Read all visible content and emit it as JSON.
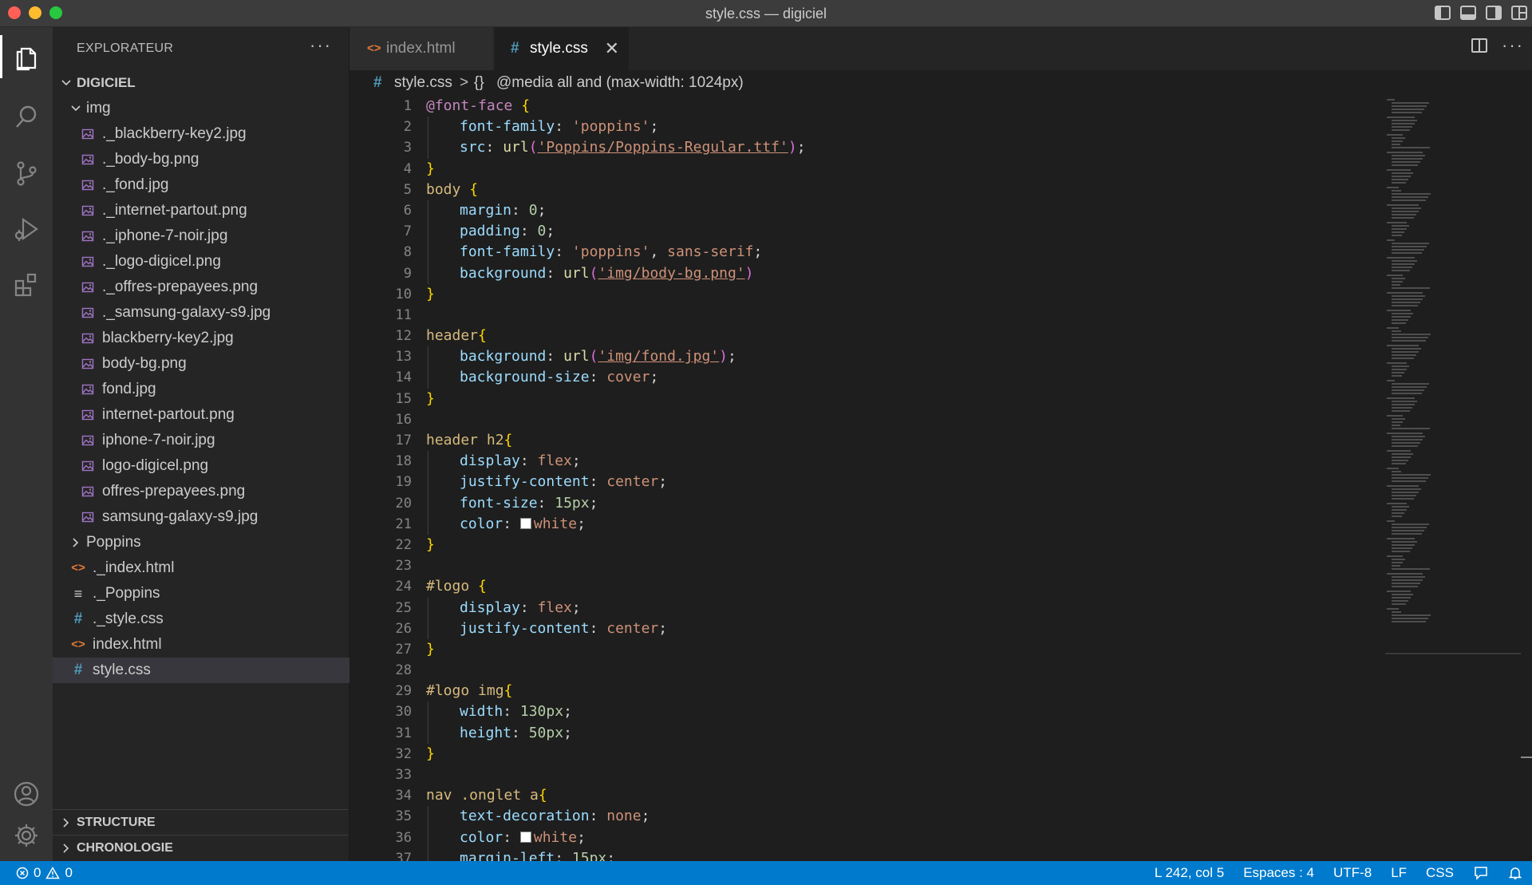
{
  "window": {
    "title": "style.css — digiciel"
  },
  "sidebar": {
    "title": "EXPLORATEUR",
    "more": "···",
    "root": "DIGICIEL",
    "img_folder": "img",
    "img_files": [
      "._blackberry-key2.jpg",
      "._body-bg.png",
      "._fond.jpg",
      "._internet-partout.png",
      "._iphone-7-noir.jpg",
      "._logo-digicel.png",
      "._offres-prepayees.png",
      "._samsung-galaxy-s9.jpg",
      "blackberry-key2.jpg",
      "body-bg.png",
      "fond.jpg",
      "internet-partout.png",
      "iphone-7-noir.jpg",
      "logo-digicel.png",
      "offres-prepayees.png",
      "samsung-galaxy-s9.jpg"
    ],
    "poppins_folder": "Poppins",
    "root_files": [
      {
        "name": "._index.html",
        "icon": "html-icon"
      },
      {
        "name": "._Poppins",
        "icon": "text-file-icon"
      },
      {
        "name": "._style.css",
        "icon": "css-hash-icon"
      },
      {
        "name": "index.html",
        "icon": "html-icon"
      },
      {
        "name": "style.css",
        "icon": "css-hash-icon",
        "selected": true
      }
    ],
    "sections": [
      "STRUCTURE",
      "CHRONOLOGIE"
    ]
  },
  "tabs": [
    {
      "label": "index.html",
      "icon": "<>",
      "active": false
    },
    {
      "label": "style.css",
      "icon": "#",
      "active": true,
      "close": "✕"
    }
  ],
  "breadcrumb": {
    "hash": "#",
    "file": "style.css",
    "sep": ">",
    "braces": "{}",
    "media": "@media all and (max-width: 1024px)"
  },
  "editor": {
    "line_numbers": [
      "1",
      "2",
      "3",
      "4",
      "5",
      "6",
      "7",
      "8",
      "9",
      "10",
      "11",
      "12",
      "13",
      "14",
      "15",
      "16",
      "17",
      "18",
      "19",
      "20",
      "21",
      "22",
      "23",
      "24",
      "25",
      "26",
      "27",
      "28",
      "29",
      "30",
      "31",
      "32",
      "33",
      "34",
      "35",
      "36",
      "37"
    ],
    "code": {
      "l1_at": "@font-face",
      "l1_brace": " {",
      "l2_prop": "font-family",
      "l2_val": "'poppins'",
      "l3_prop": "src",
      "l3_fn": "url",
      "l3_str": "'Poppins/Poppins-Regular.ttf'",
      "l4": "}",
      "l5_sel": "body",
      "l5_brace": " {",
      "l6_prop": "margin",
      "l6_val": "0",
      "l7_prop": "padding",
      "l7_val": "0",
      "l8_prop": "font-family",
      "l8_val1": "'poppins'",
      "l8_val2": "sans-serif",
      "l9_prop": "background",
      "l9_fn": "url",
      "l9_str": "'img/body-bg.png'",
      "l10": "}",
      "l12_sel": "header",
      "l12_brace": "{",
      "l13_prop": "background",
      "l13_fn": "url",
      "l13_str": "'img/fond.jpg'",
      "l14_prop": "background-size",
      "l14_val": "cover",
      "l15": "}",
      "l17_sel": "header h2",
      "l17_brace": "{",
      "l18_prop": "display",
      "l18_val": "flex",
      "l19_prop": "justify-content",
      "l19_val": "center",
      "l20_prop": "font-size",
      "l20_val": "15px",
      "l21_prop": "color",
      "l21_val": "white",
      "l22": "}",
      "l24_sel": "#logo",
      "l24_brace": " {",
      "l25_prop": "display",
      "l25_val": "flex",
      "l26_prop": "justify-content",
      "l26_val": "center",
      "l27": "}",
      "l29_sel": "#logo img",
      "l29_brace": "{",
      "l30_prop": "width",
      "l30_val": "130px",
      "l31_prop": "height",
      "l31_val": "50px",
      "l32": "}",
      "l34_sel": "nav .onglet a",
      "l34_brace": "{",
      "l35_prop": "text-decoration",
      "l35_val": "none",
      "l36_prop": "color",
      "l36_val": "white",
      "l37_prop": "margin-left",
      "l37_val": "15px"
    }
  },
  "statusbar": {
    "errors": "0",
    "warnings": "0",
    "position": "L 242, col 5",
    "spaces": "Espaces : 4",
    "encoding": "UTF-8",
    "eol": "LF",
    "language": "CSS"
  },
  "colors": {
    "accent": "#007acc",
    "activitybar": "#333333",
    "sidebar": "#252526",
    "editor": "#1e1e1e"
  }
}
